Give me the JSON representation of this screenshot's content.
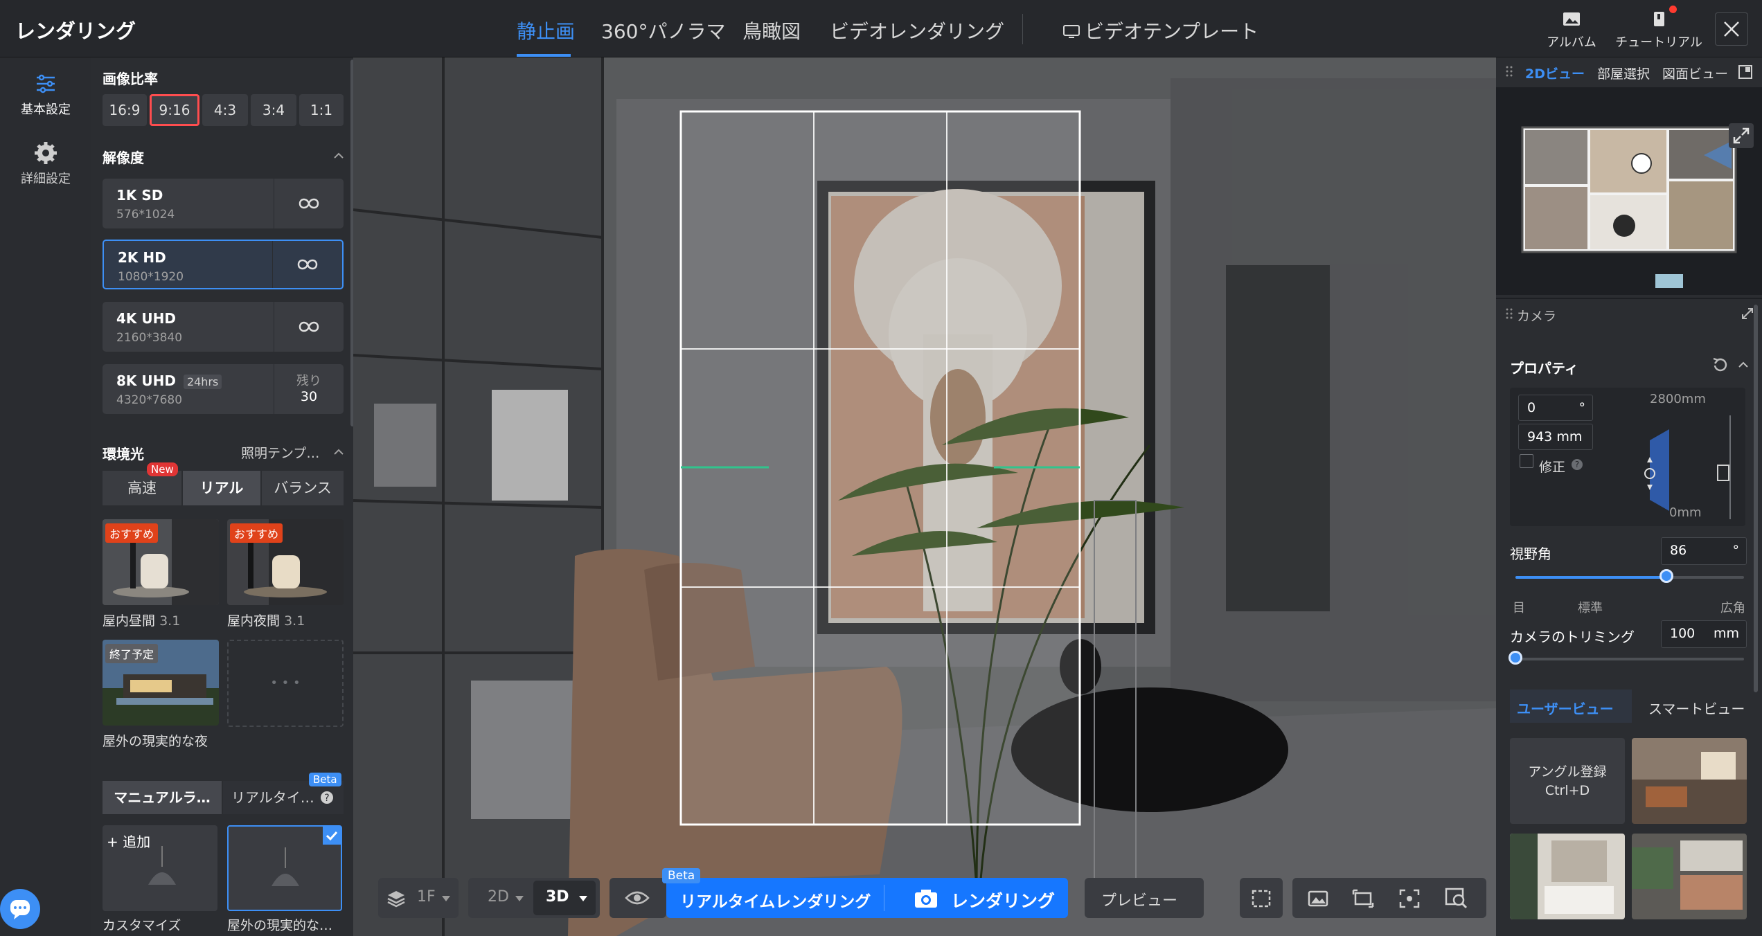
{
  "app": {
    "title": "レンダリング"
  },
  "nav": {
    "tabs": [
      {
        "label": "静止画",
        "active": true
      },
      {
        "label": "360°パノラマ"
      },
      {
        "label": "鳥瞰図"
      },
      {
        "label": "ビデオレンダリング"
      }
    ],
    "video_template": "ビデオテンプレート",
    "album": "アルバム",
    "tutorial": "チュートリアル"
  },
  "rail": {
    "basic": "基本設定",
    "advanced": "詳細設定"
  },
  "image_ratio": {
    "title": "画像比率",
    "options": [
      "16:9",
      "9:16",
      "4:3",
      "3:4",
      "1:1"
    ],
    "selected": "9:16"
  },
  "resolution": {
    "title": "解像度",
    "items": [
      {
        "name": "1K SD",
        "dims": "576*1024"
      },
      {
        "name": "2K HD",
        "dims": "1080*1920",
        "selected": true
      },
      {
        "name": "4K UHD",
        "dims": "2160*3840"
      },
      {
        "name": "8K UHD",
        "tag": "24hrs",
        "dims": "4320*7680",
        "remaining_label": "残り",
        "remaining": "30"
      }
    ]
  },
  "ambient": {
    "title": "環境光",
    "template_link": "照明テンプ…",
    "modes": [
      "高速",
      "リアル",
      "バランス"
    ],
    "new_badge": "New",
    "selected": "リアル",
    "presets": [
      {
        "badge": "おすすめ",
        "name": "屋内昼間",
        "version": "3.1"
      },
      {
        "badge": "おすすめ",
        "name": "屋内夜間",
        "version": "3.1"
      },
      {
        "badge": "終了予定",
        "name": "屋外の現実的な夜"
      }
    ],
    "more": "• • •"
  },
  "lighting": {
    "tabs": [
      "マニュアルラ…",
      "リアルタイ…"
    ],
    "beta": "Beta",
    "add": "+ 追加",
    "items": [
      "カスタマイズ",
      "屋外の現実的な…"
    ]
  },
  "bottom_toolbar": {
    "floor": "1F",
    "mode_2d": "2D",
    "mode_3d": "3D",
    "realtime": "リアルタイムレンダリング",
    "beta": "Beta",
    "render": "レンダリング",
    "preview": "プレビュー"
  },
  "right_panel": {
    "tabs": [
      "2Dビュー",
      "部屋選択",
      "図面ビュー"
    ],
    "camera": "カメラ",
    "properties": "プロパティ",
    "angle_value": "0",
    "angle_unit": "°",
    "height_value": "943",
    "height_unit": "mm",
    "fix_label": "修正",
    "height_max": "2800mm",
    "height_min": "0mm",
    "fov_label": "視野角",
    "fov_value": "86",
    "fov_unit": "°",
    "fov_value_fraction": 0.66,
    "fov_ticks": [
      "目",
      "標準",
      "広角"
    ],
    "trim_label": "カメラのトリミング",
    "trim_value": "100",
    "trim_unit": "mm",
    "view_tabs": [
      "ユーザービュー",
      "スマートビュー"
    ],
    "angle_register": "アングル登録",
    "shortcut": "Ctrl+D"
  },
  "colors": {
    "accent": "#3d8ff5",
    "selected_ratio_border": "#ff4d4f",
    "badge": "#e0421a"
  }
}
